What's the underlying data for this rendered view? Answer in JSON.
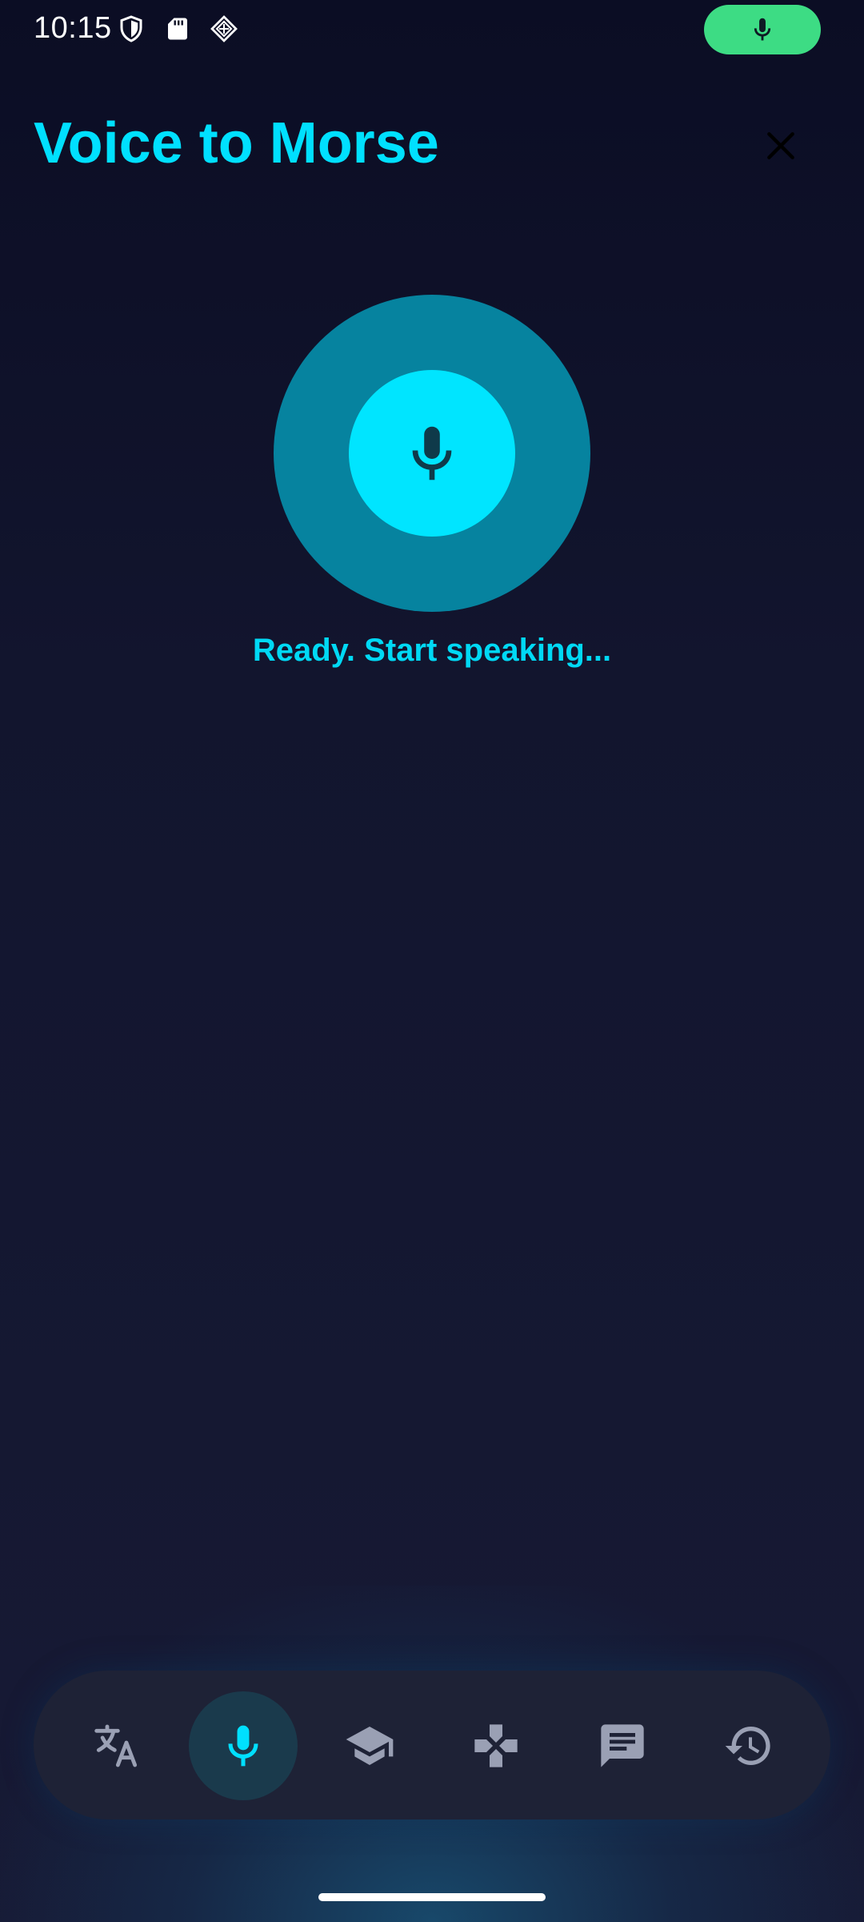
{
  "status_bar": {
    "time": "10:15",
    "icons": [
      "shield-icon",
      "sd-card-icon",
      "app-notification-icon"
    ],
    "mic_indicator": {
      "icon": "mic-icon",
      "color": "#3ddc84"
    }
  },
  "header": {
    "title": "Voice to Morse",
    "close_icon": "close-icon"
  },
  "record": {
    "icon": "mic-icon",
    "status": "Ready. Start speaking..."
  },
  "bottom_nav": {
    "items": [
      {
        "name": "translate",
        "icon": "translate-icon",
        "active": false
      },
      {
        "name": "voice",
        "icon": "mic-icon",
        "active": true
      },
      {
        "name": "learn",
        "icon": "graduation-cap-icon",
        "active": false
      },
      {
        "name": "game",
        "icon": "gamepad-icon",
        "active": false
      },
      {
        "name": "chat",
        "icon": "chat-icon",
        "active": false
      },
      {
        "name": "history",
        "icon": "history-icon",
        "active": false
      }
    ]
  },
  "colors": {
    "accent": "#00e0ff",
    "record_outer": "#06839f",
    "record_inner": "#00e5ff",
    "nav_inactive": "#9aa0b4",
    "background": "#12152e"
  }
}
